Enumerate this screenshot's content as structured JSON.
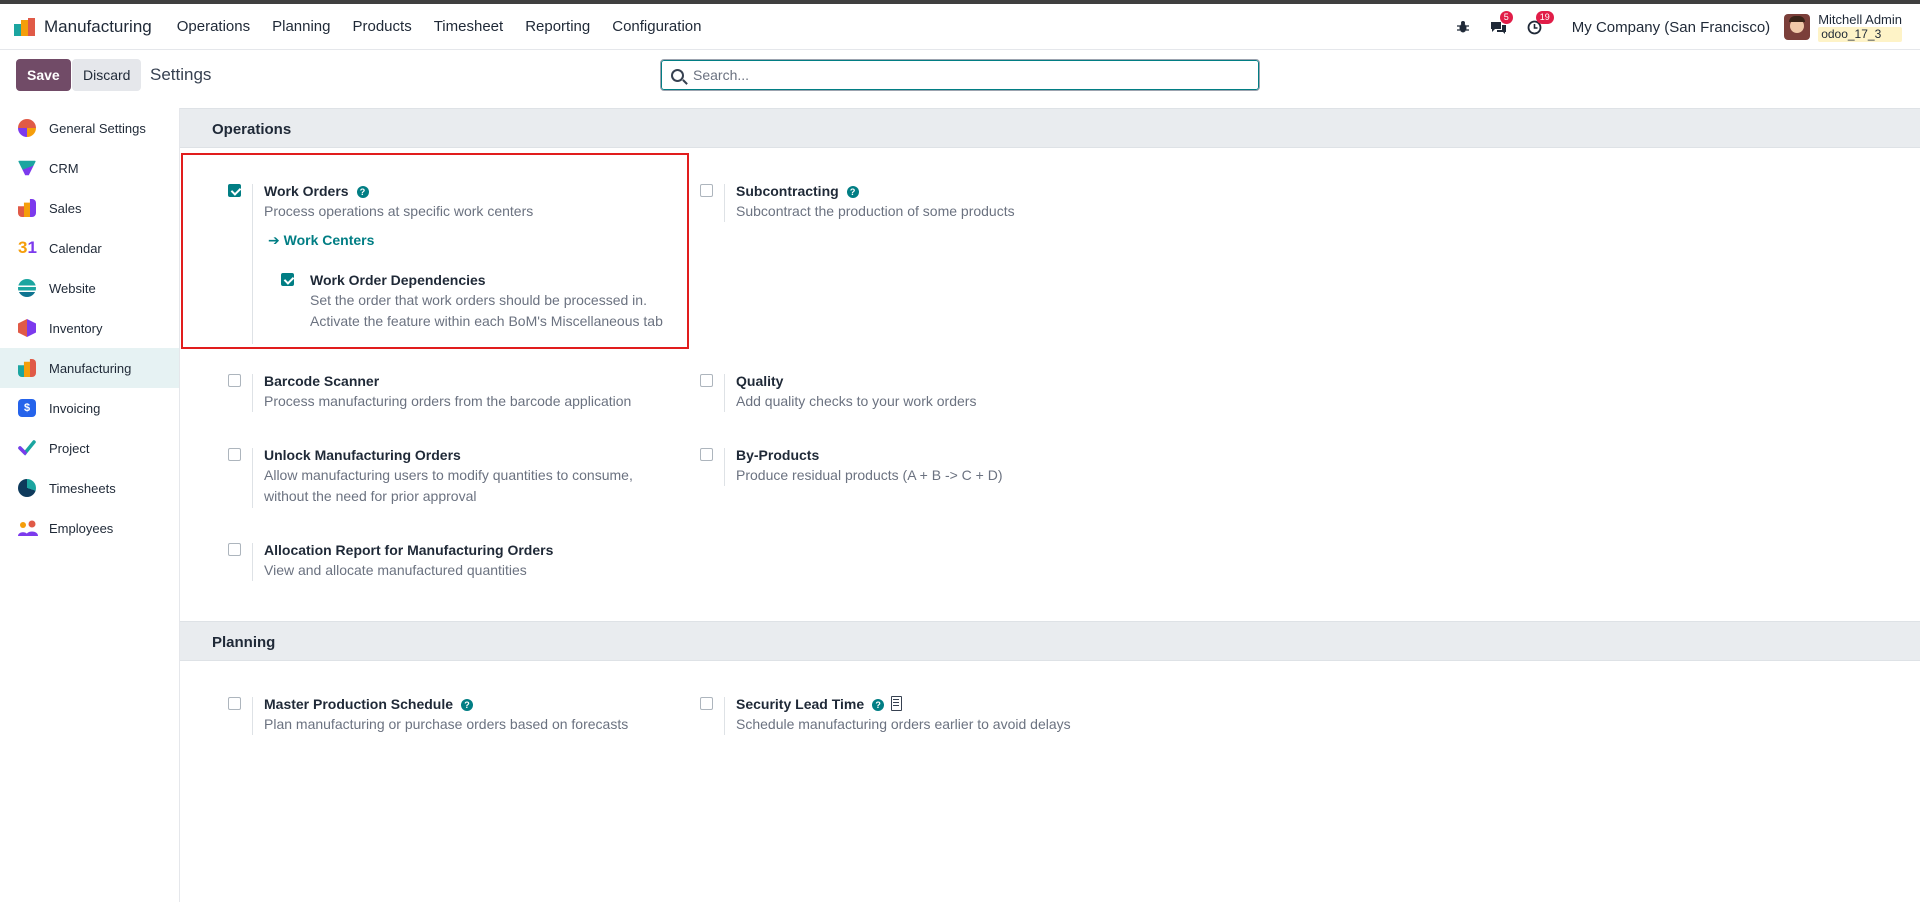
{
  "navbar": {
    "app_name": "Manufacturing",
    "menu": [
      "Operations",
      "Planning",
      "Products",
      "Timesheet",
      "Reporting",
      "Configuration"
    ],
    "messages_count": "5",
    "activities_count": "19",
    "company": "My Company (San Francisco)",
    "user_name": "Mitchell Admin",
    "database": "odoo_17_3"
  },
  "control": {
    "save_label": "Save",
    "discard_label": "Discard",
    "breadcrumb": "Settings",
    "search_placeholder": "Search..."
  },
  "sidebar": {
    "items": [
      {
        "label": "General Settings",
        "icon": "general-settings-icon"
      },
      {
        "label": "CRM",
        "icon": "crm-icon"
      },
      {
        "label": "Sales",
        "icon": "sales-icon"
      },
      {
        "label": "Calendar",
        "icon": "calendar-icon"
      },
      {
        "label": "Website",
        "icon": "website-icon"
      },
      {
        "label": "Inventory",
        "icon": "inventory-icon"
      },
      {
        "label": "Manufacturing",
        "icon": "manufacturing-icon"
      },
      {
        "label": "Invoicing",
        "icon": "invoicing-icon"
      },
      {
        "label": "Project",
        "icon": "project-icon"
      },
      {
        "label": "Timesheets",
        "icon": "timesheets-icon"
      },
      {
        "label": "Employees",
        "icon": "employees-icon"
      }
    ],
    "active": "Manufacturing"
  },
  "operations": {
    "title": "Operations",
    "work_orders": {
      "title": "Work Orders",
      "desc": "Process operations at specific work centers",
      "checked": true
    },
    "work_centers_link": "Work Centers",
    "work_order_dependencies": {
      "title": "Work Order Dependencies",
      "desc": "Set the order that work orders should be processed in. Activate the feature within each BoM's Miscellaneous tab",
      "checked": true
    },
    "subcontracting": {
      "title": "Subcontracting",
      "desc": "Subcontract the production of some products",
      "checked": false
    },
    "barcode_scanner": {
      "title": "Barcode Scanner",
      "desc": "Process manufacturing orders from the barcode application",
      "checked": false
    },
    "quality": {
      "title": "Quality",
      "desc": "Add quality checks to your work orders",
      "checked": false
    },
    "unlock_mo": {
      "title": "Unlock Manufacturing Orders",
      "desc": "Allow manufacturing users to modify quantities to consume, without the need for prior approval",
      "checked": false
    },
    "by_products": {
      "title": "By-Products",
      "desc": "Produce residual products (A + B -> C + D)",
      "checked": false
    },
    "allocation_report": {
      "title": "Allocation Report for Manufacturing Orders",
      "desc": "View and allocate manufactured quantities",
      "checked": false
    }
  },
  "planning": {
    "title": "Planning",
    "mps": {
      "title": "Master Production Schedule",
      "desc": "Plan manufacturing or purchase orders based on forecasts",
      "checked": false
    },
    "security_lead_time": {
      "title": "Security Lead Time",
      "desc": "Schedule manufacturing orders earlier to avoid delays",
      "checked": false
    }
  },
  "colors": {
    "brand": "#714b67",
    "accent": "#017e84",
    "highlight": "#e11d1d"
  }
}
